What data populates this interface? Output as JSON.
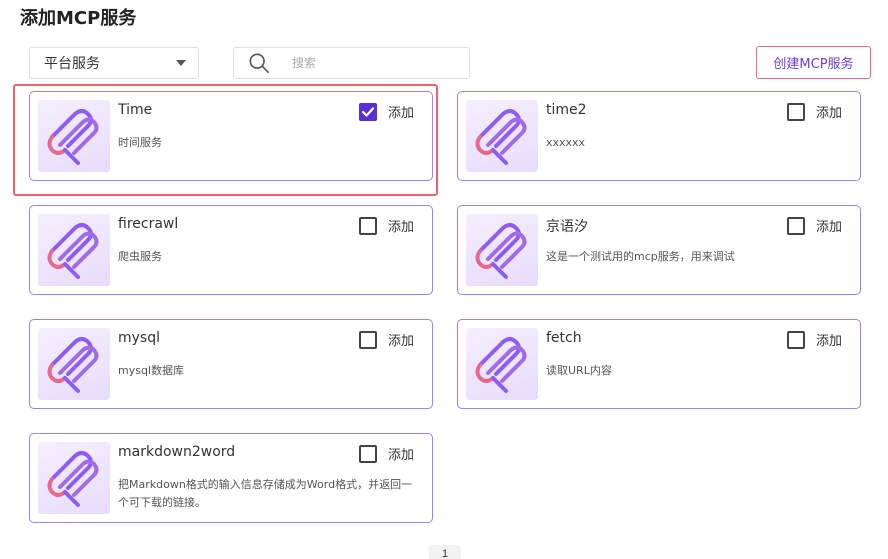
{
  "page": {
    "title": "添加MCP服务"
  },
  "filter": {
    "selected": "平台服务"
  },
  "search": {
    "placeholder": "搜索"
  },
  "actions": {
    "create_label": "创建MCP服务"
  },
  "add_label": "添加",
  "services": [
    {
      "name": "Time",
      "desc": "时间服务",
      "checked": true
    },
    {
      "name": "time2",
      "desc": "xxxxxx",
      "checked": false
    },
    {
      "name": "firecrawl",
      "desc": "爬虫服务",
      "checked": false
    },
    {
      "name": "京语汐",
      "desc": "这是一个测试用的mcp服务，用来调试",
      "checked": false
    },
    {
      "name": "mysql",
      "desc": "mysql数据库",
      "checked": false
    },
    {
      "name": "fetch",
      "desc": "读取URL内容",
      "checked": false
    },
    {
      "name": "markdown2word",
      "desc": "把Markdown格式的输入信息存储成为Word格式，并返回一个可下载的链接。",
      "checked": false
    }
  ],
  "pagination": {
    "current": "1"
  },
  "colors": {
    "accent": "#5b2fd6",
    "card_border": "#9d82f2",
    "highlight": "#f0606e"
  }
}
